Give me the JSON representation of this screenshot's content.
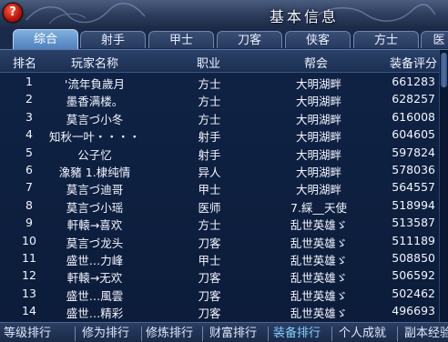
{
  "window": {
    "title": "基本信息",
    "help_label": "?"
  },
  "tabs": [
    {
      "label": "综合",
      "active": true
    },
    {
      "label": "射手",
      "active": false
    },
    {
      "label": "甲士",
      "active": false
    },
    {
      "label": "刀客",
      "active": false
    },
    {
      "label": "侠客",
      "active": false
    },
    {
      "label": "方士",
      "active": false
    },
    {
      "label": "医",
      "active": false
    }
  ],
  "table": {
    "headers": {
      "rank": "排名",
      "name": "玩家名称",
      "job": "职业",
      "guild": "帮会",
      "score": "装备评分"
    },
    "rows": [
      {
        "rank": "1",
        "name": "'流年負歲月",
        "job": "方士",
        "guild": "大明湖畔",
        "score": "661283"
      },
      {
        "rank": "2",
        "name": "墨香满楼。",
        "job": "方士",
        "guild": "大明湖畔",
        "score": "628257"
      },
      {
        "rank": "3",
        "name": "莫言づ小冬",
        "job": "方士",
        "guild": "大明湖畔",
        "score": "616008"
      },
      {
        "rank": "4",
        "name": "知秋一叶・・・・",
        "job": "射手",
        "guild": "大明湖畔",
        "score": "604605"
      },
      {
        "rank": "5",
        "name": "公子忆",
        "job": "射手",
        "guild": "大明湖畔",
        "score": "597824"
      },
      {
        "rank": "6",
        "name": "潒豬 1.棣纯情",
        "job": "异人",
        "guild": "大明湖畔",
        "score": "578036"
      },
      {
        "rank": "7",
        "name": "莫言づ迪哥",
        "job": "甲士",
        "guild": "大明湖畔",
        "score": "564557"
      },
      {
        "rank": "8",
        "name": "莫言づ小瑶",
        "job": "医师",
        "guild": "7.綵__天使",
        "score": "518994"
      },
      {
        "rank": "9",
        "name": "軒轅→喜欢",
        "job": "方士",
        "guild": "乱世英雄ゞ",
        "score": "513587"
      },
      {
        "rank": "10",
        "name": "莫言づ龙头",
        "job": "刀客",
        "guild": "乱世英雄ゞ",
        "score": "511189"
      },
      {
        "rank": "11",
        "name": "盛世…力峰",
        "job": "甲士",
        "guild": "乱世英雄ゞ",
        "score": "508850"
      },
      {
        "rank": "12",
        "name": "軒轅→无欢",
        "job": "刀客",
        "guild": "乱世英雄ゞ",
        "score": "506592"
      },
      {
        "rank": "13",
        "name": "盛世…風雲",
        "job": "刀客",
        "guild": "乱世英雄ゞ",
        "score": "502462"
      },
      {
        "rank": "14",
        "name": "盛世…精彩",
        "job": "刀客",
        "guild": "乱世英雄ゞ",
        "score": "496693"
      }
    ]
  },
  "bottom_tabs": [
    {
      "label": "等级排行",
      "active": false
    },
    {
      "label": "修为排行",
      "active": false
    },
    {
      "label": "修炼排行",
      "active": false
    },
    {
      "label": "财富排行",
      "active": false
    },
    {
      "label": "装备排行",
      "active": true
    },
    {
      "label": "个人成就",
      "active": false
    },
    {
      "label": "副本经验",
      "active": false
    }
  ],
  "colors": {
    "background": "#0b1a33",
    "active_tab": "#4f80bc",
    "active_bottom_tab": "#7fd0ff"
  }
}
